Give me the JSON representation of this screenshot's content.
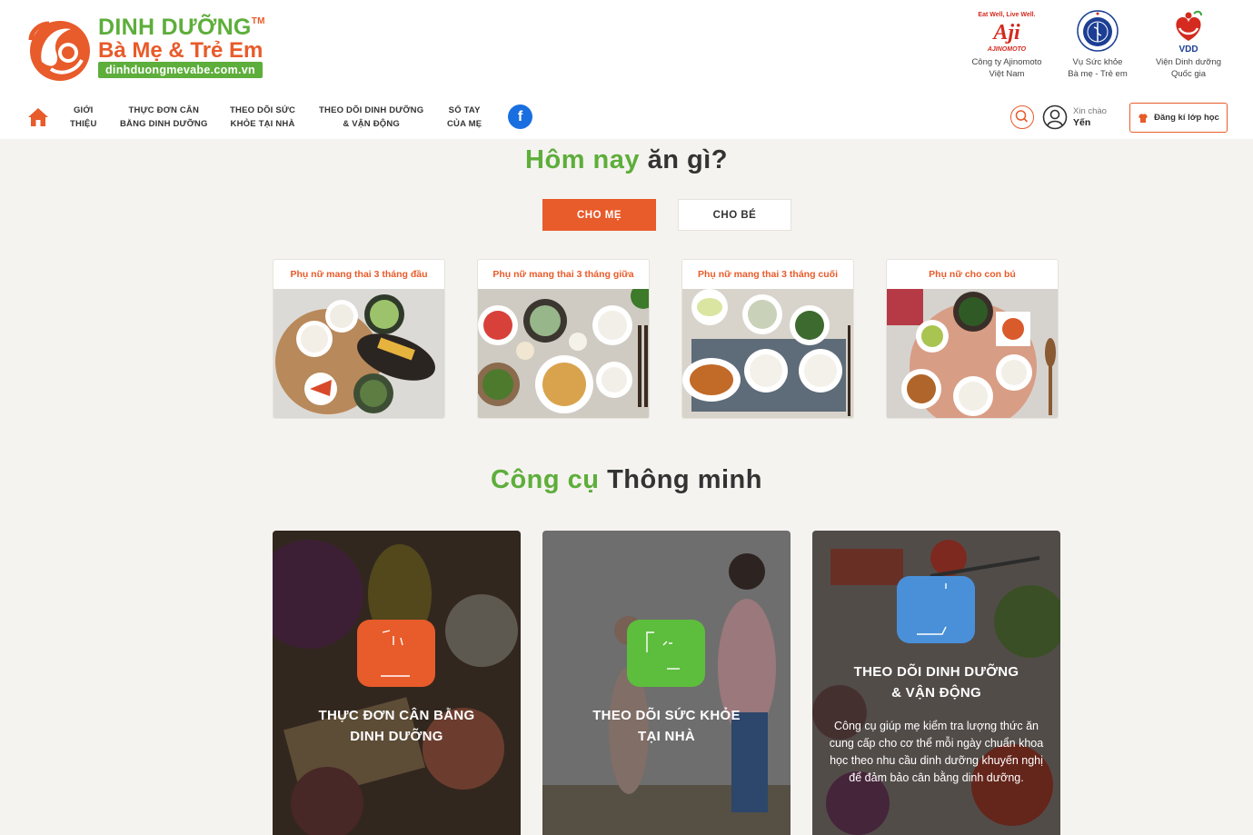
{
  "brand": {
    "line1": "DINH DƯỠNG",
    "tm": "TM",
    "line2": "Bà Mẹ & Trẻ Em",
    "url": "dinhduongmevabe.com.vn"
  },
  "partners": [
    {
      "name": "Công ty Ajinomoto\nViệt Nam",
      "logo_text_top": "Eat Well, Live Well.",
      "logo_text_mark": "Aji",
      "logo_text_bottom": "AJINOMOTO"
    },
    {
      "name": "Vụ Sức khỏe\nBà mẹ - Trẻ em"
    },
    {
      "name": "Viện Dinh dưỡng\nQuốc gia",
      "logo_text": "VDD"
    }
  ],
  "nav": {
    "items": [
      {
        "line1": "GIỚI",
        "line2": "THIỆU"
      },
      {
        "line1": "THỰC ĐƠN CÂN",
        "line2": "BẰNG DINH DƯỠNG"
      },
      {
        "line1": "THEO DÕI SỨC",
        "line2": "KHỎE TẠI NHÀ"
      },
      {
        "line1": "THEO DÕI DINH DƯỠNG",
        "line2": "& VẬN ĐỘNG"
      },
      {
        "line1": "SỔ TAY",
        "line2": "CỦA MẸ"
      }
    ],
    "facebook": "f",
    "greeting": "Xin chào",
    "username": "Yến",
    "register_label": "Đăng kí lớp học"
  },
  "menu_section": {
    "title_hl": "Hôm nay",
    "title_rest": " ăn gì?",
    "tabs": [
      {
        "label": "CHO MẸ",
        "active": true
      },
      {
        "label": "CHO BÉ",
        "active": false
      }
    ],
    "cards": [
      {
        "title": "Phụ nữ mang thai 3 tháng đầu"
      },
      {
        "title": "Phụ nữ mang thai 3 tháng giữa"
      },
      {
        "title": "Phụ nữ mang thai 3 tháng cuối"
      },
      {
        "title": "Phụ nữ cho con bú"
      }
    ]
  },
  "tools_section": {
    "title_hl": "Công cụ",
    "title_rest": " Thông minh",
    "tools": [
      {
        "line1": "THỰC ĐƠN CÂN BẰNG",
        "line2": "DINH DƯỠNG",
        "color": "#e85b2a"
      },
      {
        "line1": "THEO DÕI SỨC KHỎE",
        "line2": "TẠI NHÀ",
        "color": "#5dbd3d"
      },
      {
        "line1": "THEO DÕI DINH DƯỠNG",
        "line2": "& VẬN ĐỘNG",
        "color": "#4a90d9",
        "desc": "Công cụ giúp mẹ kiểm tra lượng thức ăn cung cấp cho cơ thể mỗi ngày chuẩn khoa học theo nhu cầu dinh dưỡng khuyến nghị để đảm bảo cân bằng dinh dưỡng."
      }
    ]
  },
  "colors": {
    "accent": "#e85b2a",
    "green": "#5dae3b",
    "background": "#f5f3ef",
    "facebook": "#1a6fe0"
  }
}
